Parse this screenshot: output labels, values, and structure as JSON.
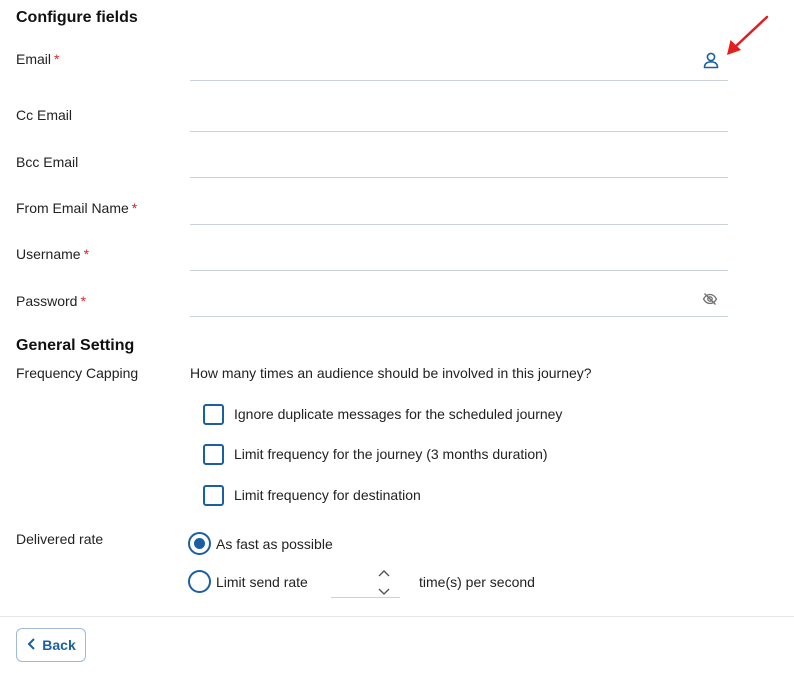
{
  "configure": {
    "heading": "Configure fields",
    "fields": [
      {
        "label": "Email",
        "required": true,
        "value": ""
      },
      {
        "label": "Cc Email",
        "required": false,
        "value": ""
      },
      {
        "label": "Bcc Email",
        "required": false,
        "value": ""
      },
      {
        "label": "From Email Name",
        "required": true,
        "value": ""
      },
      {
        "label": "Username",
        "required": true,
        "value": ""
      },
      {
        "label": "Password",
        "required": true,
        "value": ""
      }
    ],
    "required_mark": "*",
    "email_icon": "person-icon",
    "password_icon": "eye-off-icon"
  },
  "general": {
    "heading": "General Setting",
    "frequency_label": "Frequency Capping",
    "frequency_question": "How many times an audience should be involved in this journey?",
    "options": [
      {
        "label": "Ignore duplicate messages for the scheduled journey",
        "checked": false
      },
      {
        "label": "Limit frequency for the journey (3 months duration)",
        "checked": false
      },
      {
        "label": "Limit frequency for destination",
        "checked": false
      }
    ],
    "delivered_label": "Delivered rate",
    "rate_options": [
      {
        "label": "As fast as possible",
        "selected": true
      },
      {
        "label": "Limit send rate",
        "selected": false
      }
    ],
    "rate_value": "",
    "rate_unit": "time(s) per second"
  },
  "footer": {
    "back_label": "Back"
  },
  "colors": {
    "accent": "#1b5fa3",
    "required": "#d6262c",
    "annotation_arrow": "#e21f1f"
  }
}
